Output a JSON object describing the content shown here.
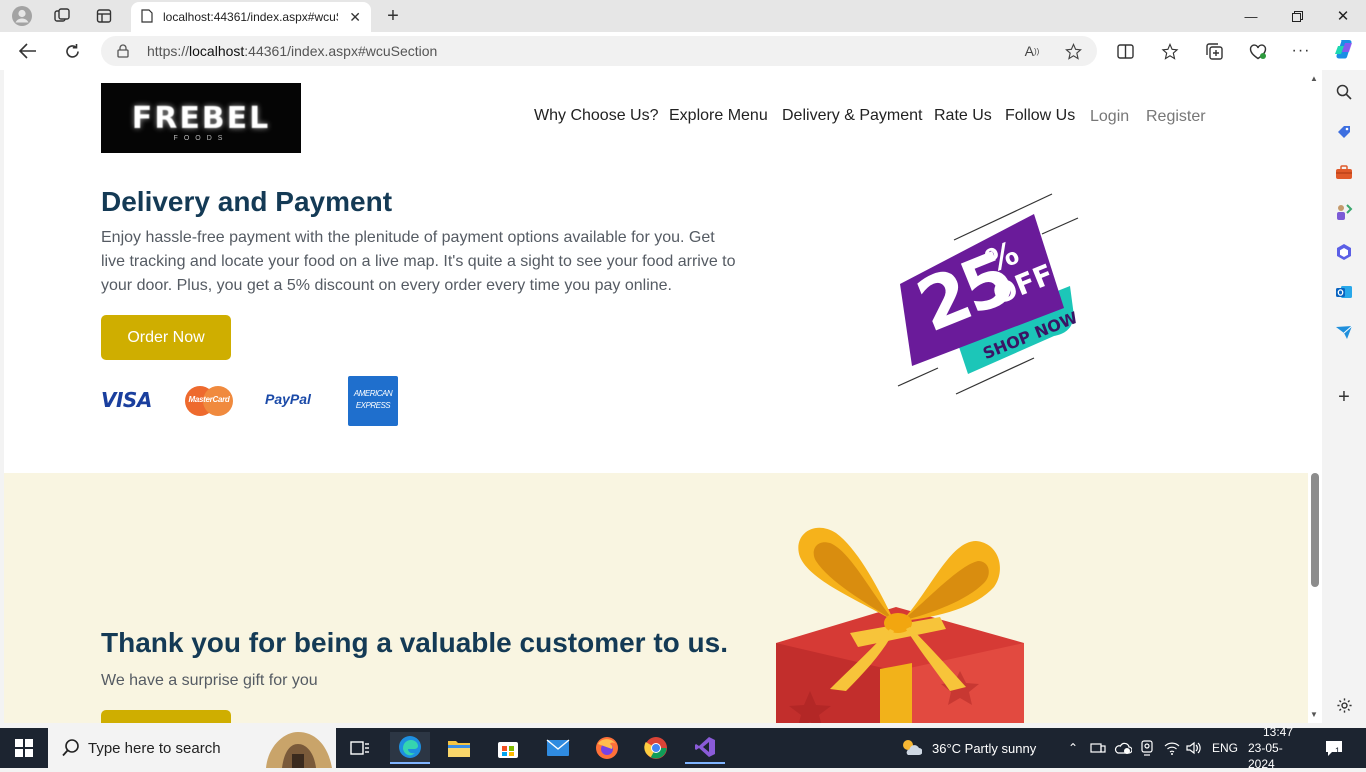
{
  "browser": {
    "tab_title": "localhost:44361/index.aspx#wcuS",
    "url_scheme": "https://",
    "url_host": "localhost",
    "url_rest": ":44361/index.aspx#wcuSection"
  },
  "site": {
    "logo_text": "FREBEL",
    "logo_sub": "FOODS",
    "nav": [
      "Why Choose Us?",
      "Explore Menu",
      "Delivery & Payment",
      "Rate Us",
      "Follow Us",
      "Login",
      "Register"
    ]
  },
  "delivery": {
    "heading": "Delivery and Payment",
    "line1": "Enjoy hassle-free payment with the plenitude of payment options available for you. Get",
    "line2": "live tracking and locate your food on a live map. It's quite a sight to see your food arrive to",
    "line3": "your door. Plus, you get a 5% discount on every order every time you pay online.",
    "button": "Order Now",
    "payments": [
      "VISA",
      "MasterCard",
      "PayPal",
      "AMERICAN EXPRESS"
    ],
    "promo_big": "25",
    "promo_pct": "%",
    "promo_off": "OFF",
    "promo_shop": "SHOP NOW"
  },
  "thanks": {
    "heading": "Thank you for being a valuable customer to us.",
    "subtext": "We have a surprise gift for you"
  },
  "taskbar": {
    "search_placeholder": "Type here to search",
    "weather": "36°C  Partly sunny",
    "lang": "ENG",
    "time": "13:47",
    "date": "23-05-2024",
    "notif_count": "1"
  },
  "colors": {
    "accent_button": "#cfae00",
    "heading": "#143a55",
    "promo_purple": "#6a1b9a",
    "promo_teal": "#1cc6b8",
    "thanks_bg": "#f9f5e1"
  }
}
